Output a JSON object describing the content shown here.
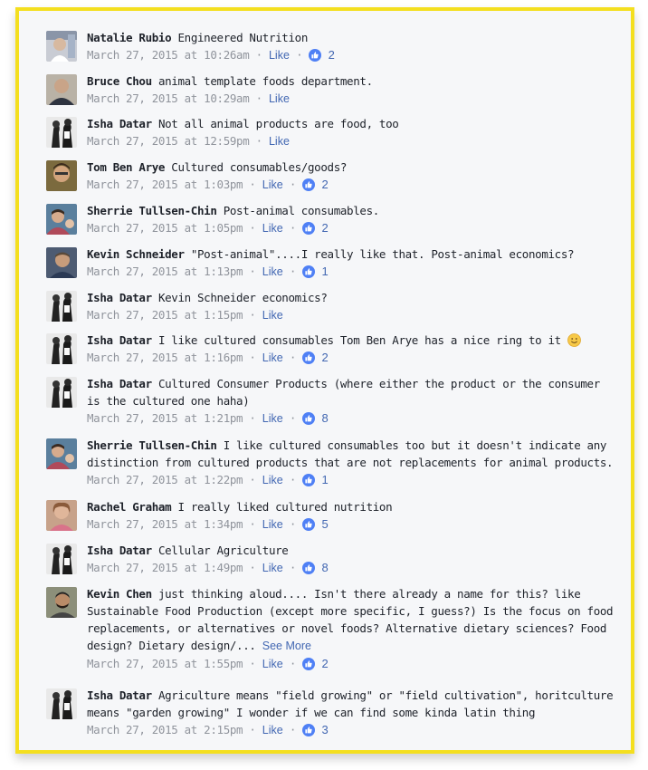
{
  "icons": {
    "like_reaction": "thumbs-up-icon",
    "emoji": "smiley-emoji-icon"
  },
  "colors": {
    "frame_border": "#f4df1f",
    "link": "#4267b2",
    "meta": "#90949c"
  },
  "ui": {
    "like_label": "Like",
    "separator": "·",
    "see_more": "See More"
  },
  "comments": [
    {
      "author": "Natalie Rubio",
      "text": "Engineered Nutrition",
      "timestamp": "March 27, 2015 at 10:26am",
      "likes": "2"
    },
    {
      "author": "Bruce Chou",
      "text": "animal template foods department.",
      "timestamp": "March 27, 2015 at 10:29am",
      "likes": ""
    },
    {
      "author": "Isha Datar",
      "text": "Not all animal products are food, too",
      "timestamp": "March 27, 2015 at 12:59pm",
      "likes": ""
    },
    {
      "author": "Tom Ben Arye",
      "text": "Cultured consumables/goods?",
      "timestamp": "March 27, 2015 at 1:03pm",
      "likes": "2"
    },
    {
      "author": "Sherrie Tullsen-Chin",
      "text": "Post-animal consumables.",
      "timestamp": "March 27, 2015 at 1:05pm",
      "likes": "2"
    },
    {
      "author": "Kevin Schneider",
      "text": "\"Post-animal\"....I really like that. Post-animal economics?",
      "timestamp": "March 27, 2015 at 1:13pm",
      "likes": "1"
    },
    {
      "author": "Isha Datar",
      "text": "Kevin Schneider economics?",
      "timestamp": "March 27, 2015 at 1:15pm",
      "likes": ""
    },
    {
      "author": "Isha Datar",
      "text": "I like cultured consumables Tom Ben Arye has a nice ring to it",
      "timestamp": "March 27, 2015 at 1:16pm",
      "likes": "2"
    },
    {
      "author": "Isha Datar",
      "text": "Cultured Consumer Products (where either the product or the consumer is the cultured one haha)",
      "timestamp": "March 27, 2015 at 1:21pm",
      "likes": "8"
    },
    {
      "author": "Sherrie Tullsen-Chin",
      "text": "I like cultured consumables too but it doesn't indicate any distinction from cultured products that are not replacements for animal products.",
      "timestamp": "March 27, 2015 at 1:22pm",
      "likes": "1"
    },
    {
      "author": "Rachel Graham",
      "text": "I really liked cultured nutrition",
      "timestamp": "March 27, 2015 at 1:34pm",
      "likes": "5"
    },
    {
      "author": "Isha Datar",
      "text": "Cellular Agriculture",
      "timestamp": "March 27, 2015 at 1:49pm",
      "likes": "8"
    },
    {
      "author": "Kevin Chen",
      "text": "just thinking aloud.... Isn't there already a name for this? like Sustainable Food Production (except more specific, I guess?) Is the focus on food replacements, or alternatives or novel foods? Alternative dietary sciences? Food design? Dietary design/...",
      "timestamp": "March 27, 2015 at 1:55pm",
      "likes": "2"
    },
    {
      "author": "Isha Datar",
      "text": "Agriculture means \"field growing\" or \"field cultivation\", horitculture means \"garden growing\" I wonder if we can find some kinda latin thing",
      "timestamp": "March 27, 2015 at 2:15pm",
      "likes": "3"
    }
  ]
}
